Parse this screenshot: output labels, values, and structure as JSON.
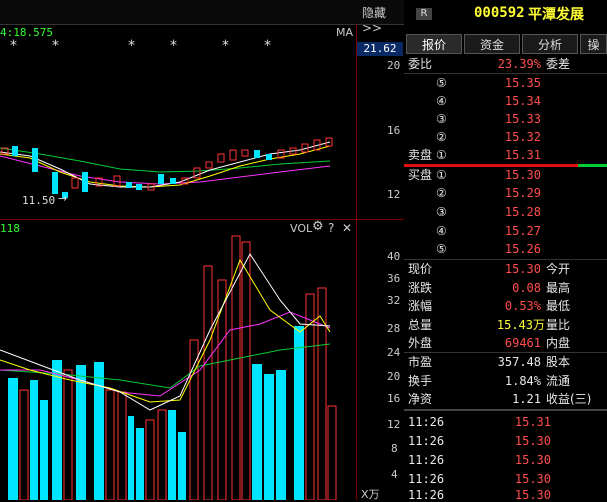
{
  "header": {
    "hide_label": "隐藏",
    "hide_arrows": ">>",
    "badge": "R",
    "code": "000592",
    "name": "平潭发展"
  },
  "kline": {
    "info_text": "4:18.575",
    "ma_label": "MA",
    "price_tag": "21.62",
    "y_ticks": [
      "20",
      "16",
      "12"
    ],
    "low_label": "11.50"
  },
  "volume": {
    "info_text": "118",
    "vol_label": "VOL",
    "help": "?",
    "close": "✕",
    "y_ticks": [
      "40",
      "36",
      "32",
      "28",
      "24",
      "20",
      "16",
      "12",
      "8",
      "4"
    ],
    "unit": "X万"
  },
  "tabs": [
    "报价",
    "资金",
    "分析",
    "操"
  ],
  "orderbook": {
    "ratio_label": "委比",
    "ratio_value": "23.39%",
    "diff_label": "委差",
    "sell_label": "卖盘",
    "buy_label": "买盘",
    "sells": [
      {
        "level": "⑤",
        "price": "15.35"
      },
      {
        "level": "④",
        "price": "15.34"
      },
      {
        "level": "③",
        "price": "15.33"
      },
      {
        "level": "②",
        "price": "15.32"
      },
      {
        "level": "①",
        "price": "15.31"
      }
    ],
    "buys": [
      {
        "level": "①",
        "price": "15.30"
      },
      {
        "level": "②",
        "price": "15.29"
      },
      {
        "level": "③",
        "price": "15.28"
      },
      {
        "level": "④",
        "price": "15.27"
      },
      {
        "level": "⑤",
        "price": "15.26"
      }
    ]
  },
  "stats": [
    {
      "label": "现价",
      "value": "15.30",
      "label2": "今开"
    },
    {
      "label": "涨跌",
      "value": "0.08",
      "label2": "最高"
    },
    {
      "label": "涨幅",
      "value": "0.53%",
      "label2": "最低"
    },
    {
      "label": "总量",
      "value": "15.43万",
      "label2": "量比"
    },
    {
      "label": "外盘",
      "value": "69461",
      "label2": "内盘"
    }
  ],
  "stats2": [
    {
      "label": "市盈",
      "value": "357.48",
      "label2": "股本"
    },
    {
      "label": "换手",
      "value": "1.84%",
      "label2": "流通"
    },
    {
      "label": "净资",
      "value": "1.21",
      "label2": "收益(三)"
    }
  ],
  "ticks": [
    {
      "time": "11:26",
      "price": "15.31"
    },
    {
      "time": "11:26",
      "price": "15.30"
    },
    {
      "time": "11:26",
      "price": "15.30"
    },
    {
      "time": "11:26",
      "price": "15.30"
    },
    {
      "time": "11:26",
      "price": "15.30"
    }
  ],
  "colors": {
    "up": "#ff3333",
    "down": "#00ffff",
    "ma5": "#ffffff",
    "ma10": "#ffff00",
    "ma20": "#ff00ff",
    "ma60": "#00ff00"
  }
}
